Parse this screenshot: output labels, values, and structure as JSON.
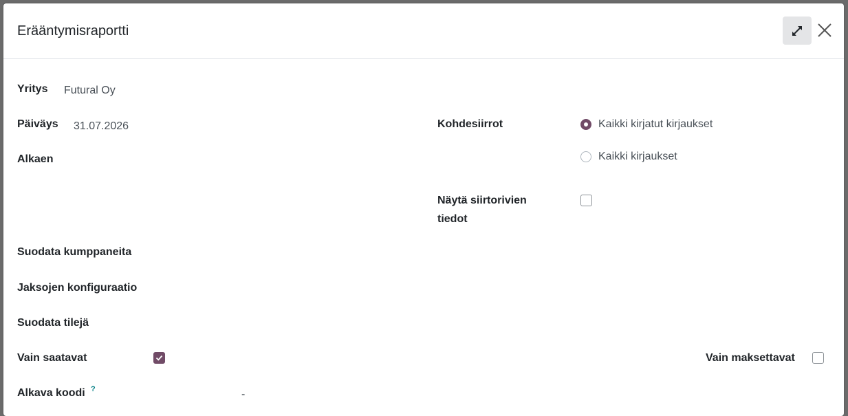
{
  "dialog": {
    "title": "Erääntymisraportti",
    "expand_icon": "expand-arrows-icon",
    "close_icon": "close-x-icon"
  },
  "fields": {
    "company": {
      "label": "Yritys",
      "value": "Futural Oy"
    },
    "date": {
      "label": "Päiväys",
      "value": "31.07.2026"
    },
    "from": {
      "label": "Alkaen",
      "value": ""
    },
    "filter_partners": {
      "label": "Suodata kumppaneita"
    },
    "period_config": {
      "label": "Jaksojen konfiguraatio"
    },
    "filter_accounts": {
      "label": "Suodata tilejä"
    },
    "only_receivables": {
      "label": "Vain saatavat",
      "checked": true
    },
    "only_payables": {
      "label": "Vain maksettavat",
      "checked": false
    },
    "start_code": {
      "label": "Alkava koodi",
      "tooltip_mark": "?",
      "value": "-"
    },
    "target_moves": {
      "label": "Kohdesiirrot",
      "options": [
        {
          "label": "Kaikki kirjatut kirjaukset",
          "selected": true
        },
        {
          "label": "Kaikki kirjaukset",
          "selected": false
        }
      ]
    },
    "show_move_lines": {
      "label_line1": "Näytä siirtorivien",
      "label_line2": "tiedot",
      "checked": false
    }
  },
  "colors": {
    "accent": "#714b67",
    "backdrop": "#6b6b6b",
    "tooltip": "#017e84"
  }
}
